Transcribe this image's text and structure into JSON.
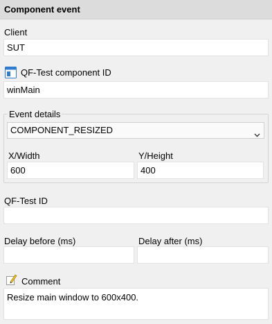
{
  "header": {
    "title": "Component event"
  },
  "client": {
    "label": "Client",
    "value": "SUT"
  },
  "component_id": {
    "label": "QF-Test component ID",
    "value": "winMain",
    "icon": "component-window-icon"
  },
  "event_details": {
    "legend": "Event details",
    "event_type": "COMPONENT_RESIZED",
    "width": {
      "label": "X/Width",
      "value": "600"
    },
    "height": {
      "label": "Y/Height",
      "value": "400"
    }
  },
  "qftest_id": {
    "label": "QF-Test ID",
    "value": ""
  },
  "delay_before": {
    "label": "Delay before (ms)",
    "value": ""
  },
  "delay_after": {
    "label": "Delay after (ms)",
    "value": ""
  },
  "comment": {
    "label": "Comment",
    "value": "Resize main window to 600x400.",
    "icon": "pencil-note-icon"
  },
  "colors": {
    "header_bg": "#dcdcdc",
    "panel_bg": "#f0f0f0",
    "icon_blue": "#2e7bcf",
    "pencil_yellow": "#f2c21b"
  }
}
